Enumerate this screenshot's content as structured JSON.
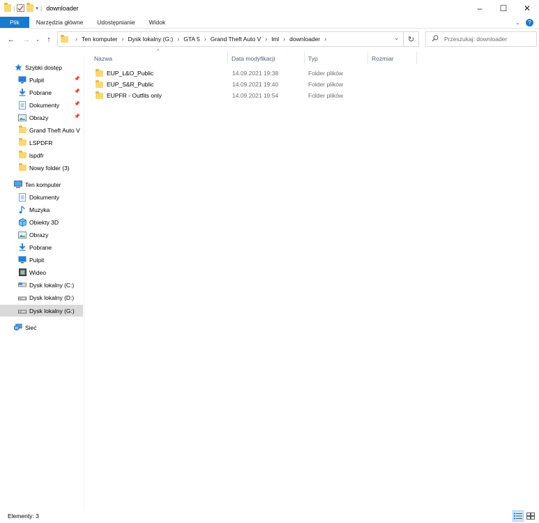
{
  "window": {
    "title": "downloader"
  },
  "ribbon": {
    "tabs": [
      "Plik",
      "Narzędzia główne",
      "Udostępnianie",
      "Widok"
    ]
  },
  "address": {
    "crumbs": [
      "Ten komputer",
      "Dysk lokalny (G:)",
      "GTA 5",
      "Grand Theft Auto V",
      "lml",
      "downloader"
    ]
  },
  "search": {
    "placeholder": "Przeszukaj: downloader"
  },
  "sidebar": {
    "items": [
      {
        "label": "Szybki dostęp",
        "icon": "star-icon"
      },
      {
        "label": "Pulpit",
        "icon": "desktop-icon",
        "pinned": true
      },
      {
        "label": "Pobrane",
        "icon": "download-icon",
        "pinned": true
      },
      {
        "label": "Dokumenty",
        "icon": "document-icon",
        "pinned": true
      },
      {
        "label": "Obrazy",
        "icon": "pictures-icon",
        "pinned": true
      },
      {
        "label": "Grand Theft Auto V",
        "icon": "folder-icon"
      },
      {
        "label": "LSPDFR",
        "icon": "folder-icon"
      },
      {
        "label": "lspdfr",
        "icon": "folder-icon"
      },
      {
        "label": "Nowy folder (3)",
        "icon": "folder-icon"
      },
      {
        "label": "Ten komputer",
        "icon": "computer-icon"
      },
      {
        "label": "Dokumenty",
        "icon": "document-icon"
      },
      {
        "label": "Muzyka",
        "icon": "music-icon"
      },
      {
        "label": "Obiekty 3D",
        "icon": "cube-icon"
      },
      {
        "label": "Obrazy",
        "icon": "pictures-icon"
      },
      {
        "label": "Pobrane",
        "icon": "download-icon"
      },
      {
        "label": "Pulpit",
        "icon": "desktop-icon"
      },
      {
        "label": "Wideo",
        "icon": "video-icon"
      },
      {
        "label": "Dysk lokalny (C:)",
        "icon": "drive-icon"
      },
      {
        "label": "Dysk lokalny (D:)",
        "icon": "drive-icon"
      },
      {
        "label": "Dysk lokalny (G:)",
        "icon": "drive-icon",
        "selected": true
      },
      {
        "label": "Sieć",
        "icon": "network-icon"
      }
    ]
  },
  "columns": {
    "name": "Nazwa",
    "date": "Data modyfikacji",
    "type": "Typ",
    "size": "Rozmiar"
  },
  "files": [
    {
      "name": "EUP_L&O_Public",
      "date": "14.09.2021 19:38",
      "type": "Folder plików"
    },
    {
      "name": "EUP_S&R_Public",
      "date": "14.09.2021 19:40",
      "type": "Folder plików"
    },
    {
      "name": "EUPFR - Outfits only",
      "date": "14.09.2021 19:54",
      "type": "Folder plików"
    }
  ],
  "status": {
    "text": "Elementy: 3"
  },
  "colors": {
    "accent": "#1979ca",
    "folder": "#f8d775",
    "selected": "#d9d9d9"
  }
}
